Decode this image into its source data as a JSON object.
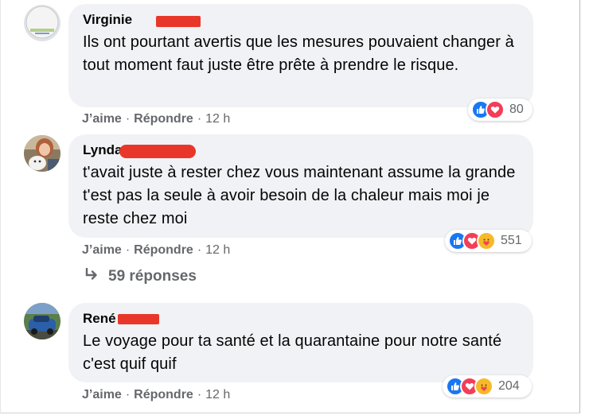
{
  "comments": [
    {
      "author": "Virginie",
      "text": "Ils ont pourtant avertis que les mesures pouvaient changer à tout moment faut juste être prête à prendre le risque.",
      "actions": {
        "like": "J’aime",
        "reply": "Répondre",
        "time": "12 h",
        "dot": "·"
      },
      "reactions": {
        "icons": [
          "like-icon",
          "love-icon"
        ],
        "count": "80"
      }
    },
    {
      "author": "Lynda",
      "text": "t'avait juste à rester chez vous maintenant assume la grande t'est pas la seule à avoir besoin de la chaleur mais moi je reste chez moi",
      "actions": {
        "like": "J’aime",
        "reply": "Répondre",
        "time": "12 h",
        "dot": "·"
      },
      "reactions": {
        "icons": [
          "like-icon",
          "love-icon",
          "care-icon"
        ],
        "count": "551"
      },
      "replies": {
        "label": "59 réponses",
        "icon": "reply-arrow-icon"
      }
    },
    {
      "author": "René",
      "text": "Le voyage pour ta santé et la quarantaine pour notre santé c'est quif quif",
      "actions": {
        "like": "J’aime",
        "reply": "Répondre",
        "time": "12 h",
        "dot": "·"
      },
      "reactions": {
        "icons": [
          "like-icon",
          "love-icon",
          "care-icon"
        ],
        "count": "204"
      }
    }
  ],
  "colors": {
    "bubble": "#f0f2f5",
    "redaction": "#e8372a",
    "like": "#1877f2",
    "love": "#f33e58",
    "care": "#f7b928",
    "secondary_text": "#65676b"
  }
}
